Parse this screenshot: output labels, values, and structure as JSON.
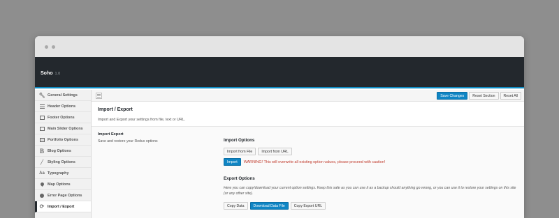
{
  "app": {
    "name": "Soho",
    "version": "1.0"
  },
  "sidebar": {
    "items": [
      {
        "label": "General Settings",
        "icon": "wrench-icon",
        "active": false
      },
      {
        "label": "Header Options",
        "icon": "menu-icon",
        "active": false
      },
      {
        "label": "Footer Options",
        "icon": "footer-box-icon",
        "active": false
      },
      {
        "label": "Main Slider Options",
        "icon": "slider-box-icon",
        "active": false
      },
      {
        "label": "Portfolio Options",
        "icon": "briefcase-icon",
        "active": false
      },
      {
        "label": "Blog Options",
        "icon": "blog-b-icon",
        "active": false
      },
      {
        "label": "Styling Options",
        "icon": "brush-icon",
        "active": false
      },
      {
        "label": "Typography",
        "icon": "typography-icon",
        "active": false
      },
      {
        "label": "Map Options",
        "icon": "map-pin-icon",
        "active": false
      },
      {
        "label": "Error Page Options",
        "icon": "error-circle-icon",
        "active": false
      },
      {
        "label": "Import / Export",
        "icon": "refresh-icon",
        "active": true
      }
    ]
  },
  "toolbar": {
    "save_label": "Save Changes",
    "reset_section_label": "Reset Section",
    "reset_all_label": "Reset All"
  },
  "section": {
    "title": "Import / Export",
    "description": "Import and Export your settings from file, text or URL."
  },
  "import_export": {
    "label": "Import Export",
    "subtitle": "Save and restore your Redux options"
  },
  "import_options": {
    "title": "Import Options",
    "from_file_label": "Import from File",
    "from_url_label": "Import from URL",
    "import_label": "Import",
    "warning": "WARNING! This will overwrite all existing option values, please proceed with caution!"
  },
  "export_options": {
    "title": "Export Options",
    "description": "Here you can copy/download your current option settings. Keep this safe as you can use it as a backup should anything go wrong, or you can use it to restore your settings on this site (or any other site).",
    "copy_data_label": "Copy Data",
    "download_label": "Download Data File",
    "copy_url_label": "Copy Export URL"
  },
  "colors": {
    "accent": "#0f85c4",
    "topbar": "#23282d",
    "warning": "#c0392b"
  }
}
